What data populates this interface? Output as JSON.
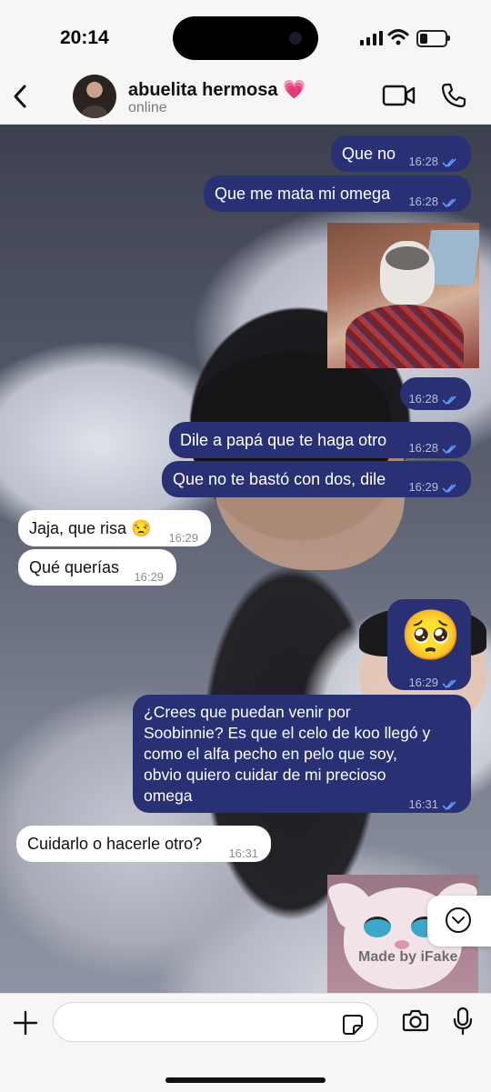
{
  "status_bar": {
    "time": "20:14"
  },
  "header": {
    "contact_name": "abuelita hermosa 💗",
    "contact_status": "online"
  },
  "messages": [
    {
      "dir": "out",
      "text": "Que no",
      "time": "16:28"
    },
    {
      "dir": "out",
      "text": "Que me mata mi omega",
      "time": "16:28"
    },
    {
      "dir": "out",
      "type": "photo",
      "time": "16:28"
    },
    {
      "dir": "out",
      "text": "Dile a papá que te haga otro",
      "time": "16:28"
    },
    {
      "dir": "out",
      "text": "Que no te bastó con dos, dile",
      "time": "16:29"
    },
    {
      "dir": "in",
      "text": "Jaja, que risa 😒",
      "time": "16:29"
    },
    {
      "dir": "in",
      "text": "Qué querías",
      "time": "16:29"
    },
    {
      "dir": "out",
      "text": "🥺",
      "time": "16:29"
    },
    {
      "dir": "out",
      "lines": [
        "¿Crees que puedan venir por",
        "Soobinnie? Es que el celo de koo llegó y",
        "como el alfa pecho en pelo que soy,",
        "obvio quiero cuidar de mi precioso",
        "omega"
      ],
      "time": "16:31"
    },
    {
      "dir": "in",
      "text": "Cuidarlo o hacerle otro?",
      "time": "16:31"
    },
    {
      "dir": "out",
      "type": "sticker",
      "watermark": "Made by iFake"
    }
  ],
  "input": {
    "placeholder": ""
  },
  "colors": {
    "outgoing": "#293174",
    "incoming": "#ffffff",
    "ticks": "#5b9bff"
  }
}
